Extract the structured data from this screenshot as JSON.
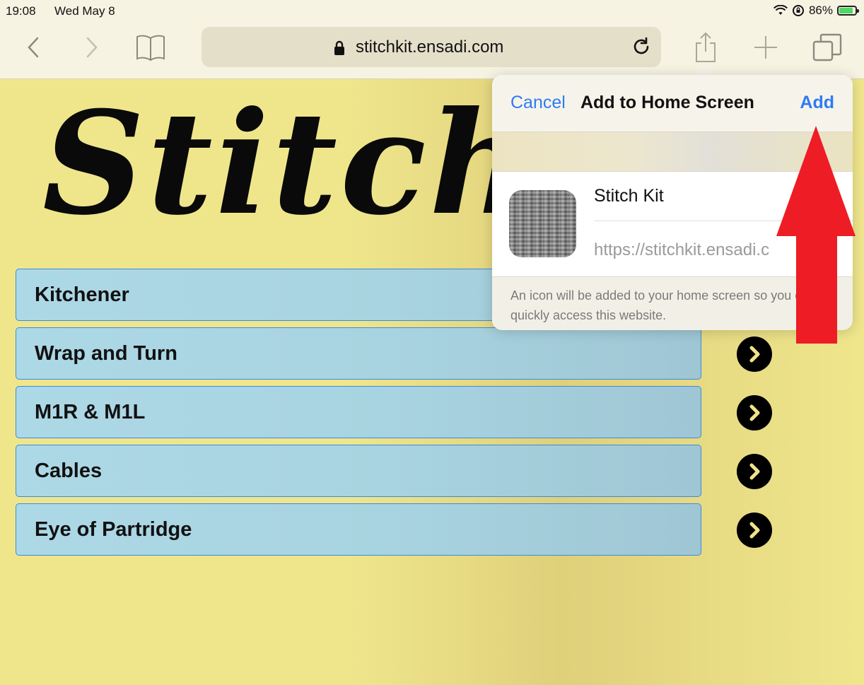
{
  "status_bar": {
    "time": "19:08",
    "date": "Wed May 8",
    "battery_percent": "86%",
    "battery_level": 0.86,
    "icons": [
      "wifi-icon",
      "orientation-lock-icon",
      "battery-icon"
    ]
  },
  "toolbar": {
    "url": "stitchkit.ensadi.com",
    "icons": [
      "back-icon",
      "forward-icon",
      "bookmarks-icon",
      "lock-icon",
      "reload-icon",
      "share-icon",
      "new-tab-icon",
      "tabs-icon"
    ]
  },
  "page": {
    "logo_text": "Stitch",
    "items": [
      {
        "label": "Kitchener"
      },
      {
        "label": "Wrap and Turn"
      },
      {
        "label": "M1R & M1L"
      },
      {
        "label": "Cables"
      },
      {
        "label": "Eye of Partridge"
      }
    ],
    "colors": {
      "background": "#efe68c",
      "item_fill": "#add8e6",
      "item_border": "#3b8be0"
    }
  },
  "popover": {
    "cancel_label": "Cancel",
    "title": "Add to Home Screen",
    "add_label": "Add",
    "app_name": "Stitch Kit",
    "app_url": "https://stitchkit.ensadi.c",
    "footer_text": "An icon will be added to your home screen so you can quickly access this website.",
    "accent_color": "#2f7bf5"
  },
  "annotation": {
    "arrow_color": "#ee1c25",
    "icon": "up-arrow-annotation"
  }
}
